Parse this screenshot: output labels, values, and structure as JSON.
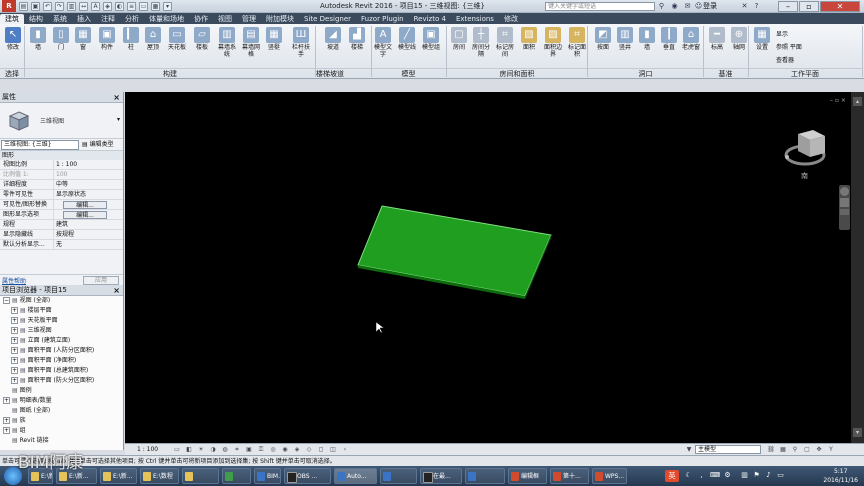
{
  "titlebar": {
    "title": "Autodesk Revit 2016 - 项目15 - 三维视图: {三维}",
    "search_placeholder": "键入关键字或短语",
    "login": "登录",
    "menu_label": "R"
  },
  "ribbon_tabs": [
    "建筑",
    "结构",
    "系统",
    "插入",
    "注释",
    "分析",
    "体量和场地",
    "协作",
    "视图",
    "管理",
    "附加模块",
    "Site Designer",
    "Fuzor Plugin",
    "Revizto 4",
    "Extensions",
    "修改"
  ],
  "ribbon": {
    "buttons": [
      {
        "label": "修改",
        "color": "#4f7ec5",
        "glyph": "↖"
      },
      {
        "label": "墙",
        "color": "#8fa9c9",
        "glyph": "▮"
      },
      {
        "label": "门",
        "color": "#8fa9c9",
        "glyph": "▯"
      },
      {
        "label": "窗",
        "color": "#8fa9c9",
        "glyph": "▦"
      },
      {
        "label": "构件",
        "color": "#8fa9c9",
        "glyph": "▣"
      },
      {
        "label": "柱",
        "color": "#8fa9c9",
        "glyph": "▎"
      },
      {
        "label": "屋顶",
        "color": "#8fa9c9",
        "glyph": "⌂"
      },
      {
        "label": "天花板",
        "color": "#8fa9c9",
        "glyph": "▭"
      },
      {
        "label": "楼板",
        "color": "#8fa9c9",
        "glyph": "▱"
      },
      {
        "label": "幕墙系统",
        "color": "#8fa9c9",
        "glyph": "▥"
      },
      {
        "label": "幕墙网格",
        "color": "#8fa9c9",
        "glyph": "▤"
      },
      {
        "label": "竖梃",
        "color": "#8fa9c9",
        "glyph": "▦"
      },
      {
        "label": "栏杆扶手",
        "color": "#8fa9c9",
        "glyph": "Ш"
      },
      {
        "label": "坡道",
        "color": "#8fa9c9",
        "glyph": "◢"
      },
      {
        "label": "楼梯",
        "color": "#8fa9c9",
        "glyph": "▟"
      },
      {
        "label": "模型文字",
        "color": "#8fa9c9",
        "glyph": "A"
      },
      {
        "label": "模型线",
        "color": "#8fa9c9",
        "glyph": "╱"
      },
      {
        "label": "模型组",
        "color": "#8fa9c9",
        "glyph": "▣"
      },
      {
        "label": "房间",
        "color": "#b0bccb",
        "glyph": "▢"
      },
      {
        "label": "房间分隔",
        "color": "#b0bccb",
        "glyph": "┼"
      },
      {
        "label": "标记房间",
        "color": "#b0bccb",
        "glyph": "⌗"
      },
      {
        "label": "面积",
        "color": "#d7b560",
        "glyph": "▧"
      },
      {
        "label": "面积边界",
        "color": "#d7b560",
        "glyph": "▨"
      },
      {
        "label": "标记面积",
        "color": "#d7b560",
        "glyph": "⌗"
      },
      {
        "label": "按面",
        "color": "#8fa9c9",
        "glyph": "◩"
      },
      {
        "label": "竖井",
        "color": "#8fa9c9",
        "glyph": "▥"
      },
      {
        "label": "墙",
        "color": "#8fa9c9",
        "glyph": "▮"
      },
      {
        "label": "垂直",
        "color": "#8fa9c9",
        "glyph": "┃"
      },
      {
        "label": "老虎窗",
        "color": "#8fa9c9",
        "glyph": "⌂"
      },
      {
        "label": "标高",
        "color": "#b0bccb",
        "glyph": "━"
      },
      {
        "label": "轴网",
        "color": "#b0bccb",
        "glyph": "⊕"
      },
      {
        "label": "设置",
        "color": "#8fa9c9",
        "glyph": "▦"
      }
    ],
    "small_items": [
      "显示",
      "参照 平面",
      "查看器"
    ],
    "groups": [
      "选择",
      "构建",
      "楼梯坡道",
      "模型",
      "房间和面积",
      "洞口",
      "基准",
      "工作平面"
    ]
  },
  "properties": {
    "title": "属性",
    "type_name": "三维视图",
    "view_selector": "三维视图: {三维}",
    "edit_type": "编辑类型",
    "category": "图形",
    "rows": [
      {
        "k": "视图比例",
        "v": "1 : 100",
        "dim": false,
        "button": false
      },
      {
        "k": "比例值 1:",
        "v": "100",
        "dim": true,
        "button": false
      },
      {
        "k": "详细程度",
        "v": "中等",
        "dim": false,
        "button": false
      },
      {
        "k": "零件可见性",
        "v": "显示原状态",
        "dim": false,
        "button": false
      },
      {
        "k": "可见性/图形替换",
        "v": "编辑...",
        "dim": false,
        "button": true
      },
      {
        "k": "图形显示选项",
        "v": "编辑...",
        "dim": false,
        "button": true
      },
      {
        "k": "规程",
        "v": "建筑",
        "dim": false,
        "button": false
      },
      {
        "k": "显示隐藏线",
        "v": "按规程",
        "dim": false,
        "button": false
      },
      {
        "k": "默认分析显示...",
        "v": "无",
        "dim": false,
        "button": false
      }
    ],
    "help_link": "属性帮助",
    "apply": "应用"
  },
  "browser": {
    "title": "项目浏览器 - 项目15",
    "items": [
      {
        "label": "视图 (全部)",
        "level": 0,
        "toggle": "−"
      },
      {
        "label": "楼层平面",
        "level": 1,
        "toggle": "+"
      },
      {
        "label": "天花板平面",
        "level": 1,
        "toggle": "+"
      },
      {
        "label": "三维视图",
        "level": 1,
        "toggle": "+"
      },
      {
        "label": "立面 (建筑立面)",
        "level": 1,
        "toggle": "+"
      },
      {
        "label": "面积平面 (人防分区面积)",
        "level": 1,
        "toggle": "+"
      },
      {
        "label": "面积平面 (净面积)",
        "level": 1,
        "toggle": "+"
      },
      {
        "label": "面积平面 (总建筑面积)",
        "level": 1,
        "toggle": "+"
      },
      {
        "label": "面积平面 (防火分区面积)",
        "level": 1,
        "toggle": "+"
      },
      {
        "label": "图例",
        "level": 0,
        "toggle": ""
      },
      {
        "label": "明细表/数量",
        "level": 0,
        "toggle": "+"
      },
      {
        "label": "图纸 (全部)",
        "level": 0,
        "toggle": ""
      },
      {
        "label": "族",
        "level": 0,
        "toggle": "+"
      },
      {
        "label": "组",
        "level": 0,
        "toggle": "+"
      },
      {
        "label": "Revit 链接",
        "level": 0,
        "toggle": ""
      }
    ]
  },
  "canvas": {
    "slab_color": "#1f9e1f",
    "viewcube_label": "南"
  },
  "view_bar": {
    "scale": "1 : 100",
    "model_combo": "主模型"
  },
  "status": {
    "text": "单击可进行选择; 按 Tab 键并单击可选择其他项目; 按 Ctrl 键并单击可将新项目添加到选择集; 按 Shift 键并单击可取消选择。"
  },
  "taskbar": {
    "items": [
      {
        "label": "E:\\新...",
        "icon": "folder"
      },
      {
        "label": "E:\\新...",
        "icon": "folder"
      },
      {
        "label": "E:\\新...",
        "icon": "folder"
      },
      {
        "label": "E:\\数程",
        "icon": "folder"
      },
      {
        "label": "",
        "icon": "folder"
      },
      {
        "label": "",
        "icon": "green"
      },
      {
        "label": "BIM...",
        "icon": "blue"
      },
      {
        "label": "OBS ...",
        "icon": "black"
      },
      {
        "label": "Auto...",
        "icon": "blue"
      },
      {
        "label": "",
        "icon": "blue"
      },
      {
        "label": "在最...",
        "icon": "black"
      },
      {
        "label": "",
        "icon": "blue"
      },
      {
        "label": "编辑框",
        "icon": "red"
      },
      {
        "label": "第十...",
        "icon": "red"
      },
      {
        "label": "WPS...",
        "icon": "red"
      }
    ],
    "ime": "英",
    "time": "5:17",
    "date": "2016/11/16"
  },
  "watermark": "BIM阿康"
}
